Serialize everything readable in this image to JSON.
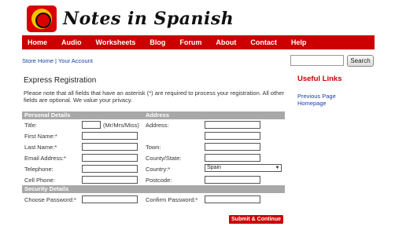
{
  "header": {
    "logo_text": "Notes in Spanish"
  },
  "nav": {
    "items": [
      "Home",
      "Audio",
      "Worksheets",
      "Blog",
      "Forum",
      "About",
      "Contact",
      "Help"
    ]
  },
  "breadcrumb": {
    "store_home": "Store Home",
    "separator": "|",
    "your_account": "Your Account"
  },
  "search": {
    "value": "",
    "button_label": "Search"
  },
  "sidebar": {
    "title": "Useful Links",
    "links": [
      "Previous Page",
      "Homepage"
    ]
  },
  "form": {
    "title": "Express Registration",
    "notice": "Please note that all fields that have an asterisk (*) are required to process your registration. All other fields are optional. We value your privacy.",
    "personal_section": "Personal Details",
    "address_section": "Address",
    "security_section": "Security Details",
    "labels": {
      "title": "Title:",
      "title_hint": "(Mr/Mrs/Miss)",
      "first_name": "First Name:*",
      "last_name": "Last Name:*",
      "email": "Email Address:*",
      "telephone": "Telephone:",
      "cell_phone": "Cell Phone:",
      "address": "Address:",
      "town": "Town:",
      "county_state": "County/State:",
      "country": "Country:*",
      "postcode": "Postcode:",
      "choose_password": "Choose Password:*",
      "confirm_password": "Confirm Password:*"
    },
    "country_value": "Spain",
    "submit_label": "Submit & Continue"
  },
  "colors": {
    "brand_red": "#cc0000",
    "link_blue": "#1a3fa0",
    "section_gray": "#a8a8a8"
  }
}
